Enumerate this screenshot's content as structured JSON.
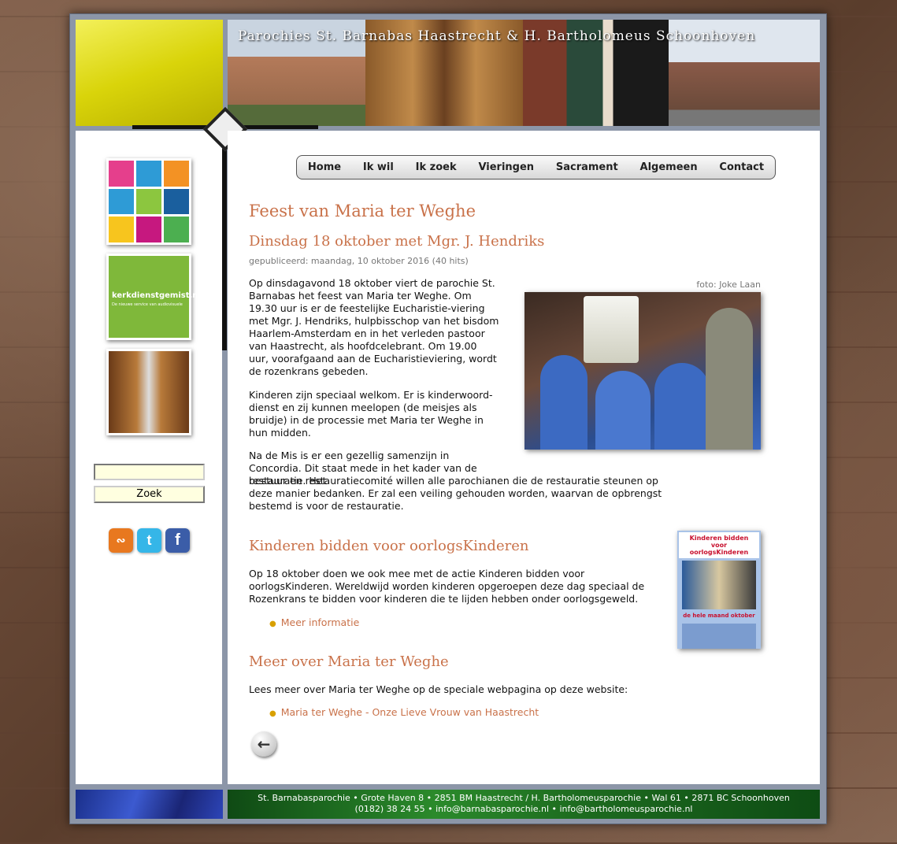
{
  "header": {
    "title": "Parochies St. Barnabas Haastrecht & H. Bartholomeus Schoonhoven"
  },
  "nav": {
    "items": [
      "Home",
      "Ik wil",
      "Ik zoek",
      "Vieringen",
      "Sacrament",
      "Algemeen",
      "Contact"
    ]
  },
  "sidebar": {
    "promo_kerkdienst": "kerkdienstgemist.nl",
    "promo_kerkdienst_sub": "De nieuwe service van audiovisuele",
    "search": {
      "placeholder": "",
      "button_label": "Zoek"
    },
    "social": [
      {
        "icon": "rss-icon",
        "color": "#e8781f"
      },
      {
        "icon": "twitter-icon",
        "color": "#35b6e8"
      },
      {
        "icon": "facebook-icon",
        "color": "#3b5da8"
      }
    ]
  },
  "article": {
    "title": "Feest van Maria ter Weghe",
    "subtitle": "Dinsdag 18 oktober met Mgr. J. Hendriks",
    "published": "gepubliceerd: maandag, 10 oktober 2016 (40 hits)",
    "photo_credit": "foto: Joke Laan",
    "p1": "Op dinsdagavond 18 oktober viert de parochie St. Barnabas het feest van Maria ter Weghe. Om 19.30 uur is er de feestelijke Eucharistie-viering met Mgr. J. Hendriks, hulpbisschop van het bisdom Haarlem-Amsterdam en in het verleden pastoor van Haastrecht, als hoofdcelebrant. Om 19.00 uur, voorafgaand aan de Eucharistieviering, wordt de rozenkrans gebeden.",
    "p2": "Kinderen zijn speciaal welkom. Er is kinderwoord-dienst en zij kunnen meelopen (de meisjes als bruidje) in de processie met Maria ter Weghe in hun midden.",
    "p3a": "Na de Mis is er een gezellig samenzijn in Concordia. Dit staat mede in het kader van de restauratie. Het",
    "p3b": "bestuur en restauratiecomité willen alle parochianen die de restauratie steunen op deze manier bedanken. Er zal een veiling gehouden worden, waarvan de opbrengst bestemd is voor de restauratie.",
    "section2_title": "Kinderen bidden voor oorlogsKinderen",
    "section2_text": "Op 18 oktober doen we ook mee met de actie Kinderen bidden voor oorlogsKinderen. Wereldwijd worden kinderen opgeroepen deze dag speciaal de Rozenkrans te bidden voor kinderen die te lijden hebben onder oorlogsgeweld.",
    "section2_link": "Meer informatie",
    "poster_title": "Kinderen bidden voor oorlogsKinderen",
    "poster_month": "de hele maand oktober",
    "section3_title": "Meer over Maria ter Weghe",
    "section3_text": "Lees meer over Maria ter Weghe op de speciale webpagina op deze website:",
    "section3_link": "Maria ter Weghe - Onze Lieve Vrouw van Haastrecht"
  },
  "footer": {
    "line1": "St. Barnabasparochie • Grote Haven 8 • 2851 BM  Haastrecht  /  H. Bartholomeusparochie • Wal 61 • 2871 BC  Schoonhoven",
    "line2": "(0182) 38 24 55 • info@barnabasparochie.nl • info@bartholomeusparochie.nl"
  }
}
